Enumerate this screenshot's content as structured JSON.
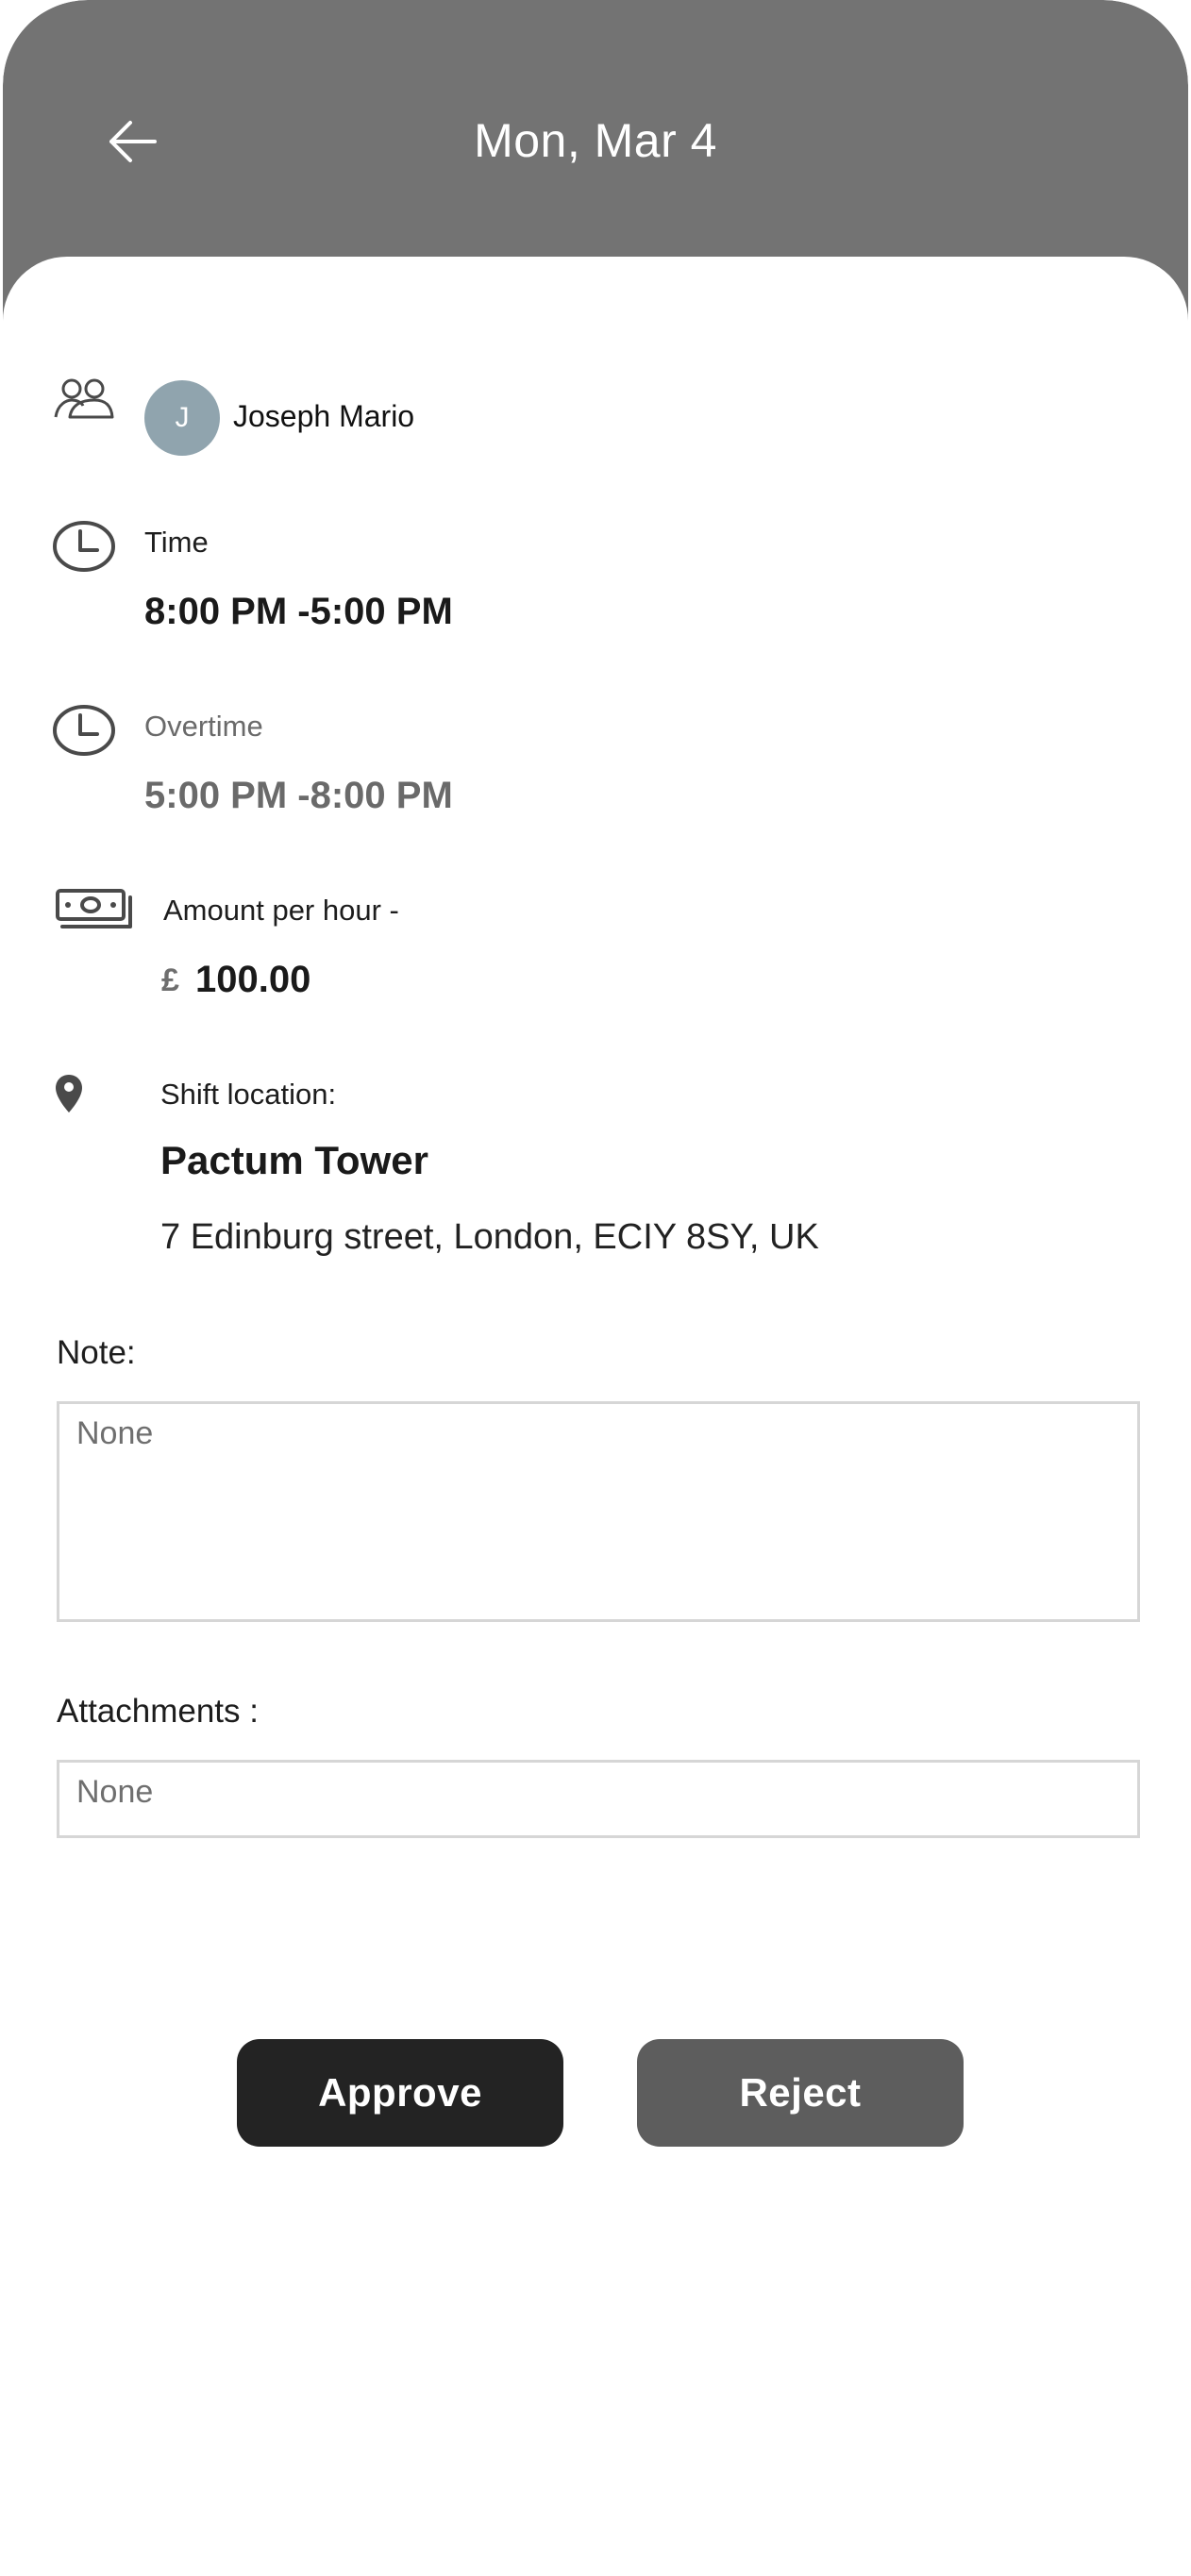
{
  "header": {
    "title": "Mon, Mar 4",
    "back_icon": "arrow-left-icon"
  },
  "employee": {
    "avatar_initial": "J",
    "name": "Joseph Mario",
    "icon": "people-icon"
  },
  "time": {
    "label": "Time",
    "value": "8:00 PM -5:00 PM",
    "icon": "clock-icon"
  },
  "overtime": {
    "label": "Overtime",
    "value": "5:00 PM -8:00 PM",
    "icon": "clock-icon"
  },
  "rate": {
    "label": "Amount per hour -",
    "currency_symbol": "£",
    "value": "100.00",
    "icon": "money-icon"
  },
  "location": {
    "label": "Shift location:",
    "name": "Pactum Tower",
    "address": "7 Edinburg street, London, ECIY 8SY, UK",
    "icon": "map-pin-icon"
  },
  "note": {
    "label": "Note:",
    "value": "None"
  },
  "attachments": {
    "label": "Attachments :",
    "value": "None"
  },
  "actions": {
    "approve_label": "Approve",
    "reject_label": "Reject"
  },
  "colors": {
    "header_bg": "#737373",
    "avatar_bg": "#90a4ae",
    "approve_bg": "#232323",
    "reject_bg": "#5d5d5d"
  }
}
